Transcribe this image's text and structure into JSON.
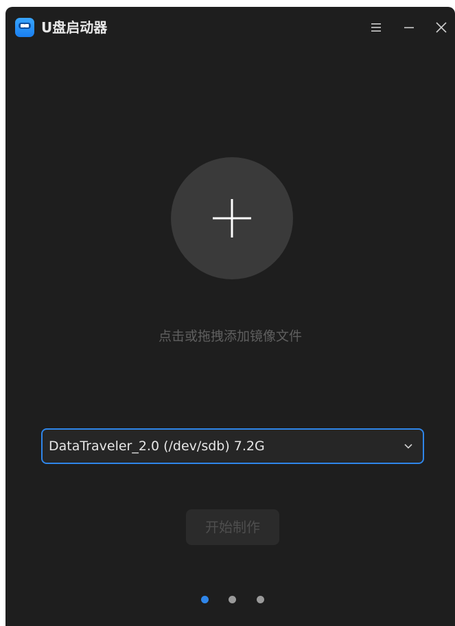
{
  "window": {
    "title": "U盘启动器"
  },
  "icons": {
    "app": "app-logo-icon",
    "menu": "hamburger-menu-icon",
    "minimize": "minimize-icon",
    "close": "close-icon",
    "add": "plus-icon",
    "dropdown": "chevron-down-icon"
  },
  "main": {
    "hint": "点击或拖拽添加镜像文件",
    "device_select": {
      "selected": "DataTraveler_2.0 (/dev/sdb) 7.2G"
    },
    "start_button": "开始制作"
  },
  "pager": {
    "total": 3,
    "active_index": 0
  },
  "colors": {
    "accent": "#2f86ea",
    "background": "#1e1e1e",
    "circle": "#3a3a3a",
    "disabled_text": "#4e4e4e"
  }
}
